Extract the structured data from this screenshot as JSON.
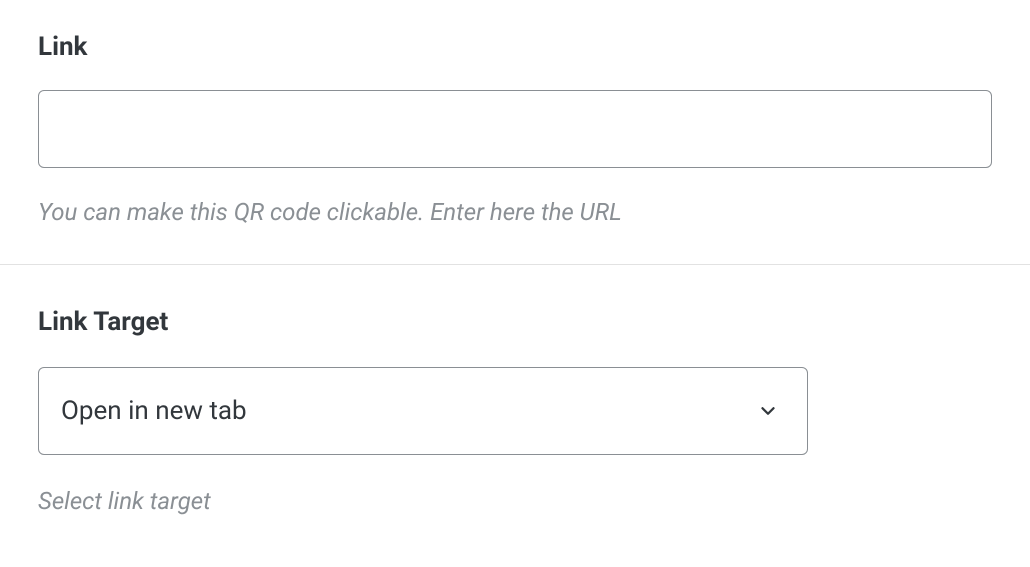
{
  "link_field": {
    "label": "Link",
    "value": "",
    "help": "You can make this QR code clickable. Enter here the URL"
  },
  "link_target_field": {
    "label": "Link Target",
    "selected": "Open in new tab",
    "help": "Select link target"
  }
}
